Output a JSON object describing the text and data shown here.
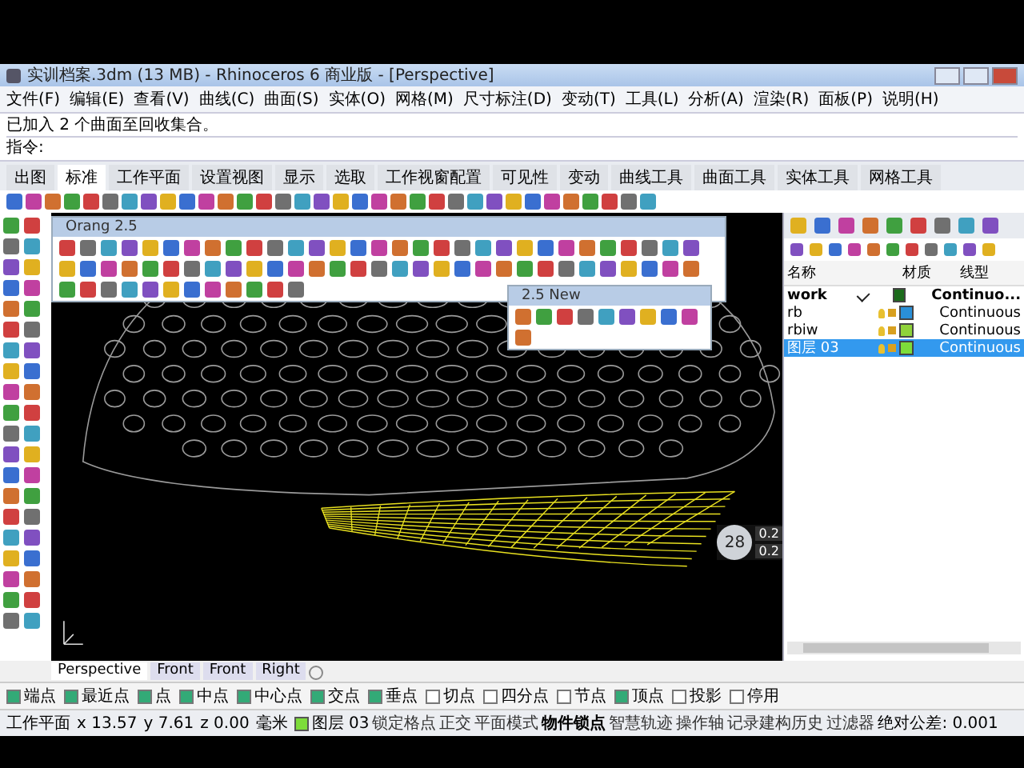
{
  "window": {
    "title": "实训档案.3dm (13 MB) - Rhinoceros 6 商业版 - [Perspective]"
  },
  "menu": [
    "文件(F)",
    "编辑(E)",
    "查看(V)",
    "曲线(C)",
    "曲面(S)",
    "实体(O)",
    "网格(M)",
    "尺寸标注(D)",
    "变动(T)",
    "工具(L)",
    "分析(A)",
    "渲染(R)",
    "面板(P)",
    "说明(H)"
  ],
  "command": {
    "history": [
      "已加入 2 个曲面至回收集合。"
    ],
    "prompt": "指令:"
  },
  "tabs": [
    {
      "label": "出图",
      "selected": false
    },
    {
      "label": "标准",
      "selected": true
    },
    {
      "label": "工作平面",
      "selected": false
    },
    {
      "label": "设置视图",
      "selected": false
    },
    {
      "label": "显示",
      "selected": false
    },
    {
      "label": "选取",
      "selected": false
    },
    {
      "label": "工作视窗配置",
      "selected": false
    },
    {
      "label": "可见性",
      "selected": false
    },
    {
      "label": "变动",
      "selected": false
    },
    {
      "label": "曲线工具",
      "selected": false
    },
    {
      "label": "曲面工具",
      "selected": false
    },
    {
      "label": "实体工具",
      "selected": false
    },
    {
      "label": "网格工具",
      "selected": false
    }
  ],
  "floating_toolbars": [
    {
      "title": "Orang 2.5"
    },
    {
      "title": "2.5 New"
    }
  ],
  "gumball": {
    "label": "28",
    "readings": [
      "0.2",
      "0.2"
    ]
  },
  "layers": {
    "columns": [
      "名称",
      "材质",
      "线型"
    ],
    "rows": [
      {
        "name": "work",
        "current": true,
        "selected": false,
        "color": "#1b6b1b",
        "linetype": "Continuo..."
      },
      {
        "name": "rb",
        "current": false,
        "selected": false,
        "color": "#2a90d8",
        "linetype": "Continuous"
      },
      {
        "name": "rbiw",
        "current": false,
        "selected": false,
        "color": "#8fd23a",
        "linetype": "Continuous"
      },
      {
        "name": "图层 03",
        "current": false,
        "selected": true,
        "color": "#7ddc3a",
        "linetype": "Continuous"
      }
    ]
  },
  "viewport_tabs": [
    {
      "label": "Perspective",
      "selected": true
    },
    {
      "label": "Front",
      "selected": false
    },
    {
      "label": "Front",
      "selected": false
    },
    {
      "label": "Right",
      "selected": false
    }
  ],
  "osnaps": [
    {
      "label": "端点",
      "checked": true
    },
    {
      "label": "最近点",
      "checked": true
    },
    {
      "label": "点",
      "checked": true
    },
    {
      "label": "中点",
      "checked": true
    },
    {
      "label": "中心点",
      "checked": true
    },
    {
      "label": "交点",
      "checked": true
    },
    {
      "label": "垂点",
      "checked": true
    },
    {
      "label": "切点",
      "checked": false
    },
    {
      "label": "四分点",
      "checked": false
    },
    {
      "label": "节点",
      "checked": false
    },
    {
      "label": "顶点",
      "checked": true
    },
    {
      "label": "投影",
      "checked": false
    },
    {
      "label": "停用",
      "checked": false
    }
  ],
  "status_bar": {
    "plane": "工作平面",
    "x": "x 13.57",
    "y": "y 7.61",
    "z": "z 0.00",
    "units": "毫米",
    "layer": "图层 03",
    "toggles": [
      {
        "label": "锁定格点",
        "on": false
      },
      {
        "label": "正交",
        "on": false
      },
      {
        "label": "平面模式",
        "on": false
      },
      {
        "label": "物件锁点",
        "on": true
      },
      {
        "label": "智慧轨迹",
        "on": false
      },
      {
        "label": "操作轴",
        "on": false
      },
      {
        "label": "记录建构历史",
        "on": false
      },
      {
        "label": "过滤器",
        "on": false
      }
    ],
    "tolerance": "绝对公差: 0.001"
  }
}
